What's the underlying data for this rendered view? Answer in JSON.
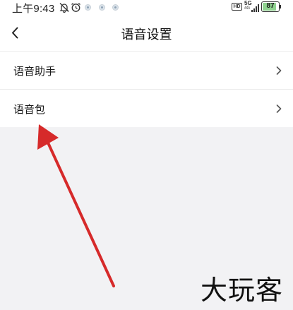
{
  "status_bar": {
    "time": "上午9:43",
    "icons": [
      "mute-bell-icon",
      "alarm-icon",
      "notification-dot-icon",
      "notification-dot-icon",
      "notification-dot-icon"
    ],
    "hd_label": "HD",
    "network": "5G",
    "network_sub": "4G",
    "battery_level": 87,
    "battery_text": "87",
    "battery_color": "#8fd28f"
  },
  "header": {
    "back_icon": "chevron-left-icon",
    "title": "语音设置"
  },
  "settings": {
    "items": [
      {
        "label": "语音助手",
        "icon": "chevron-right-icon"
      },
      {
        "label": "语音包",
        "icon": "chevron-right-icon"
      }
    ]
  },
  "annotation": {
    "arrow_color": "#d62a2a",
    "points_to": "语音包"
  },
  "watermark": {
    "text": "大玩客"
  }
}
